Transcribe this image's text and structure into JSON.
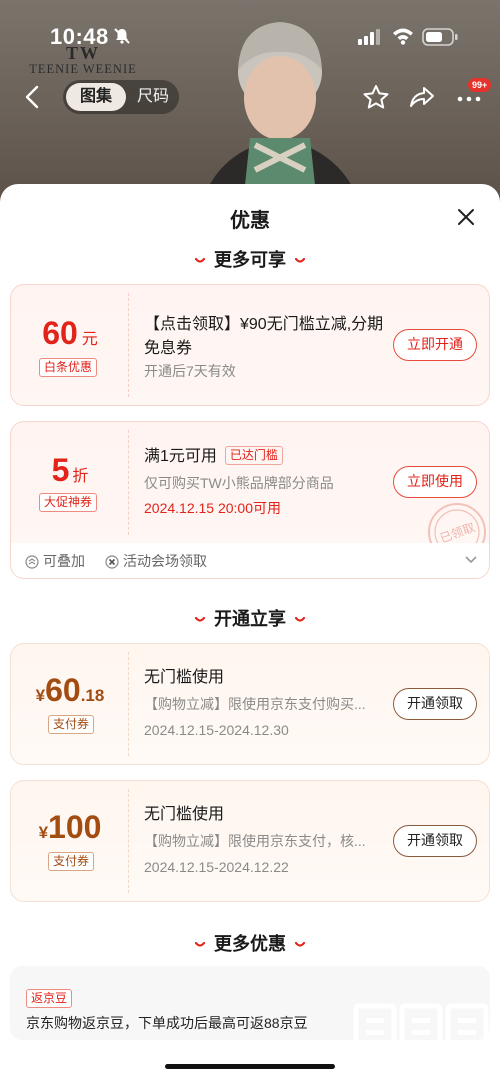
{
  "status_bar": {
    "time": "10:48"
  },
  "brand": {
    "monogram": "TW",
    "name": "TEENIE WEENIE"
  },
  "nav": {
    "tab_gallery": "图集",
    "tab_size": "尺码",
    "badge": "99+"
  },
  "sheet": {
    "title": "优惠",
    "section_more_enjoy": "更多可享",
    "section_open_enjoy": "开通立享",
    "section_more_offers": "更多优惠"
  },
  "coupons_more": [
    {
      "amount": "60",
      "unit": "元",
      "tag": "白条优惠",
      "title": "【点击领取】¥90无门槛立减,分期免息券",
      "sub": "开通后7天有效",
      "button": "立即开通"
    },
    {
      "amount": "5",
      "unit": "折",
      "tag": "大促神券",
      "title": "满1元可用",
      "reached": "已达门槛",
      "sub": "仅可购买TW小熊品牌部分商品",
      "date": "2024.12.15 20:00可用",
      "button": "立即使用",
      "stamp": "已领取",
      "footer": {
        "stackable": "可叠加",
        "venue": "活动会场领取"
      }
    }
  ],
  "coupons_open": [
    {
      "currency": "¥",
      "amount": "60",
      "decimal": ".18",
      "tag": "支付券",
      "title": "无门槛使用",
      "sub": "【购物立减】限使用京东支付购买...",
      "date": "2024.12.15-2024.12.30",
      "button": "开通领取"
    },
    {
      "currency": "¥",
      "amount": "100",
      "decimal": "",
      "tag": "支付券",
      "title": "无门槛使用",
      "sub": "【购物立减】限使用京东支付，核...",
      "date": "2024.12.15-2024.12.22",
      "button": "开通领取"
    }
  ],
  "rebate": {
    "tag": "返京豆",
    "text": "京东购物返京豆，下单成功后最高可返88京豆"
  },
  "watermark": {
    "text": "值",
    "site": "zhizhizhi.com"
  },
  "colors": {
    "accent_red": "#e2231a",
    "accent_brown": "#a24c12"
  }
}
